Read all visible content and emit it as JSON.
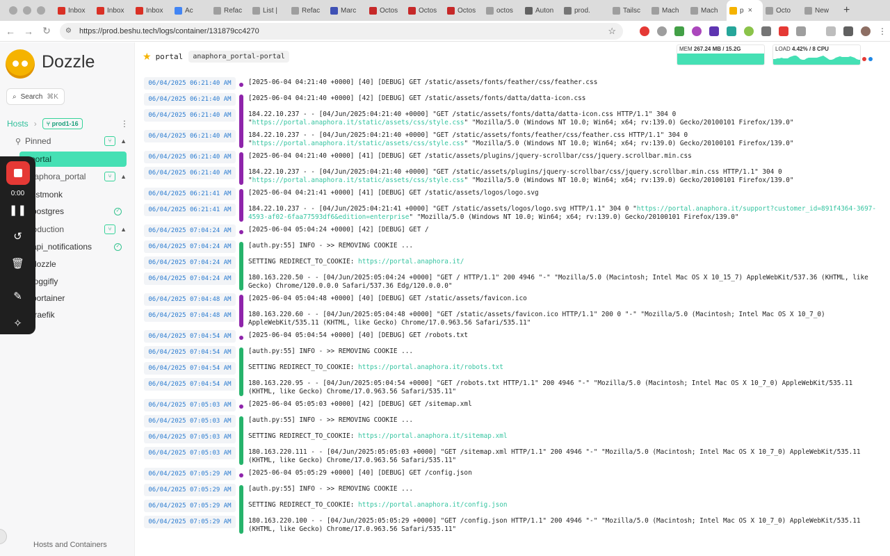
{
  "browser": {
    "tabs": [
      {
        "label": "Inbox"
      },
      {
        "label": "Inbox"
      },
      {
        "label": "Inbox"
      },
      {
        "label": "Ac"
      },
      {
        "label": "Refac"
      },
      {
        "label": "List |"
      },
      {
        "label": "Refac"
      },
      {
        "label": "Marc"
      },
      {
        "label": "Octos"
      },
      {
        "label": "Octos"
      },
      {
        "label": "Octos"
      },
      {
        "label": "octos"
      },
      {
        "label": "Auton"
      },
      {
        "label": "prod."
      },
      {
        "label": "Tailsc"
      },
      {
        "label": "Mach"
      },
      {
        "label": "Mach"
      },
      {
        "label": "p",
        "active": true
      },
      {
        "label": "Octo"
      },
      {
        "label": "New"
      }
    ],
    "url": "https://prod.beshu.tech/logs/container/131879cc4270"
  },
  "sidebar": {
    "brand": "Dozzle",
    "search_label": "Search",
    "search_shortcut": "⌘K",
    "hosts_label": "Hosts",
    "host_badge": "prod1-16",
    "groups": [
      {
        "label": "Pinned",
        "icon": "pin-icon"
      },
      {
        "label": "anaphora_portal"
      },
      {
        "label": "production"
      }
    ],
    "items": [
      {
        "label": "portal",
        "active": true
      },
      {
        "label": "listmonk"
      },
      {
        "label": "postgres",
        "healthy": true
      },
      {
        "label": "api_notifications",
        "healthy": true
      },
      {
        "label": "dozzle"
      },
      {
        "label": "loggifly"
      },
      {
        "label": "portainer"
      },
      {
        "label": "traefik"
      }
    ],
    "footer": "Hosts and Containers"
  },
  "recorder": {
    "time": "0:00"
  },
  "header": {
    "name": "portal",
    "container": "anaphora_portal-portal",
    "mem_label": "MEM",
    "mem_value": "267.24 MB / 15.2G",
    "mem_fraction": 0.017,
    "load_label": "LOAD",
    "load_value": "4.42% / 8 CPU",
    "load_fraction": 0.0442
  },
  "colors": {
    "accent": "#45e0b4",
    "purple": "#8e24aa",
    "green": "#26b36b",
    "timestamp": "#2a7bd0",
    "link": "#35c4a0"
  },
  "logs": [
    {
      "ts": "06/04/2025 06:21:40 AM",
      "parts": [
        {
          "t": "[2025-06-04 04:21:40 +0000] [40] [DEBUG] GET /static/assets/fonts/feather/css/feather.css"
        }
      ],
      "group": "p1",
      "single": true
    },
    {
      "ts": "06/04/2025 06:21:40 AM",
      "parts": [
        {
          "t": "[2025-06-04 04:21:40 +0000] [42] [DEBUG] GET /static/assets/fonts/datta/datta-icon.css"
        }
      ],
      "group": "p2"
    },
    {
      "ts": "06/04/2025 06:21:40 AM",
      "parts": [
        {
          "t": "184.22.10.237 - - [04/Jun/2025:04:21:40 +0000] \"GET /static/assets/fonts/datta/datta-icon.css HTTP/1.1\" 304 0 \""
        },
        {
          "t": "https://portal.anaphora.it/static/assets/css/style.css",
          "link": true
        },
        {
          "t": "\" \"Mozilla/5.0 (Windows NT 10.0; Win64; x64; rv:139.0) Gecko/20100101 Firefox/139.0\""
        }
      ],
      "group": "p2"
    },
    {
      "ts": "06/04/2025 06:21:40 AM",
      "parts": [
        {
          "t": "184.22.10.237 - - [04/Jun/2025:04:21:40 +0000] \"GET /static/assets/fonts/feather/css/feather.css HTTP/1.1\" 304 0 \""
        },
        {
          "t": "https://portal.anaphora.it/static/assets/css/style.css",
          "link": true
        },
        {
          "t": "\" \"Mozilla/5.0 (Windows NT 10.0; Win64; x64; rv:139.0) Gecko/20100101 Firefox/139.0\""
        }
      ],
      "group": "p2"
    },
    {
      "ts": "06/04/2025 06:21:40 AM",
      "parts": [
        {
          "t": "[2025-06-04 04:21:40 +0000] [41] [DEBUG] GET /static/assets/plugins/jquery-scrollbar/css/jquery.scrollbar.min.css"
        }
      ],
      "group": "p3"
    },
    {
      "ts": "06/04/2025 06:21:40 AM",
      "parts": [
        {
          "t": "184.22.10.237 - - [04/Jun/2025:04:21:40 +0000] \"GET /static/assets/plugins/jquery-scrollbar/css/jquery.scrollbar.min.css HTTP/1.1\" 304 0 \""
        },
        {
          "t": "https://portal.anaphora.it/static/assets/css/style.css",
          "link": true
        },
        {
          "t": "\" \"Mozilla/5.0 (Windows NT 10.0; Win64; x64; rv:139.0) Gecko/20100101 Firefox/139.0\""
        }
      ],
      "group": "p3"
    },
    {
      "ts": "06/04/2025 06:21:41 AM",
      "parts": [
        {
          "t": "[2025-06-04 04:21:41 +0000] [41] [DEBUG] GET /static/assets/logos/logo.svg"
        }
      ],
      "group": "p4"
    },
    {
      "ts": "06/04/2025 06:21:41 AM",
      "parts": [
        {
          "t": "184.22.10.237 - - [04/Jun/2025:04:21:41 +0000] \"GET /static/assets/logos/logo.svg HTTP/1.1\" 304 0 \""
        },
        {
          "t": "https://portal.anaphora.it/support?customer_id=891f4364-3697-4593-af02-6faa77593df6&edition=enterprise",
          "link": true
        },
        {
          "t": "\" \"Mozilla/5.0 (Windows NT 10.0; Win64; x64; rv:139.0) Gecko/20100101 Firefox/139.0\""
        }
      ],
      "group": "p4"
    },
    {
      "ts": "06/04/2025 07:04:24 AM",
      "parts": [
        {
          "t": "[2025-06-04 05:04:24 +0000] [42] [DEBUG] GET /"
        }
      ],
      "group": "p5",
      "single": true
    },
    {
      "ts": "06/04/2025 07:04:24 AM",
      "parts": [
        {
          "t": "[auth.py:55] INFO - >> REMOVING COOKIE ..."
        }
      ],
      "group": "g1"
    },
    {
      "ts": "06/04/2025 07:04:24 AM",
      "parts": [
        {
          "t": "SETTING REDIRECT_TO_COOKIE: "
        },
        {
          "t": "https://portal.anaphora.it/",
          "link": true
        }
      ],
      "group": "g1"
    },
    {
      "ts": "06/04/2025 07:04:24 AM",
      "parts": [
        {
          "t": "180.163.220.50 - - [04/Jun/2025:05:04:24 +0000] \"GET / HTTP/1.1\" 200 4946 \"-\" \"Mozilla/5.0 (Macintosh; Intel Mac OS X 10_15_7) AppleWebKit/537.36 (KHTML, like Gecko) Chrome/120.0.0.0 Safari/537.36 Edg/120.0.0.0\""
        }
      ],
      "group": "g1"
    },
    {
      "ts": "06/04/2025 07:04:48 AM",
      "parts": [
        {
          "t": "[2025-06-04 05:04:48 +0000] [40] [DEBUG] GET /static/assets/favicon.ico"
        }
      ],
      "group": "p6"
    },
    {
      "ts": "06/04/2025 07:04:48 AM",
      "parts": [
        {
          "t": "180.163.220.60 - - [04/Jun/2025:05:04:48 +0000] \"GET /static/assets/favicon.ico HTTP/1.1\" 200 0 \"-\" \"Mozilla/5.0 (Macintosh; Intel Mac OS X 10_7_0) AppleWebKit/535.11 (KHTML, like Gecko) Chrome/17.0.963.56 Safari/535.11\""
        }
      ],
      "group": "p6"
    },
    {
      "ts": "06/04/2025 07:04:54 AM",
      "parts": [
        {
          "t": "[2025-06-04 05:04:54 +0000] [40] [DEBUG] GET /robots.txt"
        }
      ],
      "group": "p7",
      "single": true
    },
    {
      "ts": "06/04/2025 07:04:54 AM",
      "parts": [
        {
          "t": "[auth.py:55] INFO - >> REMOVING COOKIE ..."
        }
      ],
      "group": "g2"
    },
    {
      "ts": "06/04/2025 07:04:54 AM",
      "parts": [
        {
          "t": "SETTING REDIRECT_TO_COOKIE: "
        },
        {
          "t": "https://portal.anaphora.it/robots.txt",
          "link": true
        }
      ],
      "group": "g2"
    },
    {
      "ts": "06/04/2025 07:04:54 AM",
      "parts": [
        {
          "t": "180.163.220.95 - - [04/Jun/2025:05:04:54 +0000] \"GET /robots.txt HTTP/1.1\" 200 4946 \"-\" \"Mozilla/5.0 (Macintosh; Intel Mac OS X 10_7_0) AppleWebKit/535.11 (KHTML, like Gecko) Chrome/17.0.963.56 Safari/535.11\""
        }
      ],
      "group": "g2"
    },
    {
      "ts": "06/04/2025 07:05:03 AM",
      "parts": [
        {
          "t": "[2025-06-04 05:05:03 +0000] [42] [DEBUG] GET /sitemap.xml"
        }
      ],
      "group": "p8",
      "single": true
    },
    {
      "ts": "06/04/2025 07:05:03 AM",
      "parts": [
        {
          "t": "[auth.py:55] INFO - >> REMOVING COOKIE ..."
        }
      ],
      "group": "g3"
    },
    {
      "ts": "06/04/2025 07:05:03 AM",
      "parts": [
        {
          "t": "SETTING REDIRECT_TO_COOKIE: "
        },
        {
          "t": "https://portal.anaphora.it/sitemap.xml",
          "link": true
        }
      ],
      "group": "g3"
    },
    {
      "ts": "06/04/2025 07:05:03 AM",
      "parts": [
        {
          "t": "180.163.220.111 - - [04/Jun/2025:05:05:03 +0000] \"GET /sitemap.xml HTTP/1.1\" 200 4946 \"-\" \"Mozilla/5.0 (Macintosh; Intel Mac OS X 10_7_0) AppleWebKit/535.11 (KHTML, like Gecko) Chrome/17.0.963.56 Safari/535.11\""
        }
      ],
      "group": "g3"
    },
    {
      "ts": "06/04/2025 07:05:29 AM",
      "parts": [
        {
          "t": "[2025-06-04 05:05:29 +0000] [40] [DEBUG] GET /config.json"
        }
      ],
      "group": "p9",
      "single": true
    },
    {
      "ts": "06/04/2025 07:05:29 AM",
      "parts": [
        {
          "t": "[auth.py:55] INFO - >> REMOVING COOKIE ..."
        }
      ],
      "group": "g4"
    },
    {
      "ts": "06/04/2025 07:05:29 AM",
      "parts": [
        {
          "t": "SETTING REDIRECT_TO_COOKIE: "
        },
        {
          "t": "https://portal.anaphora.it/config.json",
          "link": true
        }
      ],
      "group": "g4"
    },
    {
      "ts": "06/04/2025 07:05:29 AM",
      "parts": [
        {
          "t": "180.163.220.100 - - [04/Jun/2025:05:05:29 +0000] \"GET /config.json HTTP/1.1\" 200 4946 \"-\" \"Mozilla/5.0 (Macintosh; Intel Mac OS X 10_7_0) AppleWebKit/535.11 (KHTML, like Gecko) Chrome/17.0.963.56 Safari/535.11\""
        }
      ],
      "group": "g4"
    }
  ]
}
